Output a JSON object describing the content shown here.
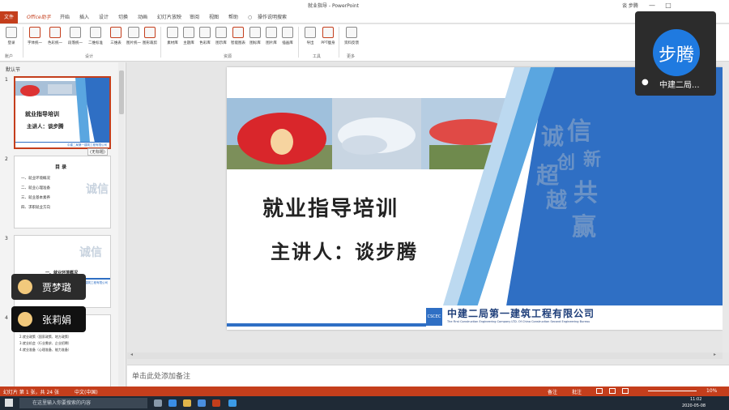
{
  "window": {
    "title": "就业指导 - PowerPoint",
    "user": "谈 步腾",
    "minimize_glyph": "—",
    "maximize_glyph": "□"
  },
  "tabs": [
    "文件",
    "Office助手",
    "开始",
    "插入",
    "设计",
    "切换",
    "动画",
    "幻灯片放映",
    "审阅",
    "视图",
    "帮助",
    "操作说明搜索"
  ],
  "ribbon": {
    "buttons": [
      "登录",
      "字体统一",
      "色彩统一",
      "段落统一",
      "二维标准",
      "三维表",
      "图片统一",
      "图形裁剪",
      "素材库",
      "主题库",
      "色彩库",
      "图示库",
      "智能图表",
      "图标库",
      "图片库",
      "插画库",
      "导出",
      "PPT瘦身",
      "资料反馈"
    ],
    "groups": [
      "账户",
      "设计",
      "资源",
      "工具",
      "更多"
    ]
  },
  "panel": {
    "section": "默认节",
    "slide_numbers": [
      "1",
      "2",
      "3",
      "4"
    ],
    "tooltip": "(无标题)",
    "thumb1": {
      "title": "就业指导培训",
      "speaker": "主讲人：谈步腾",
      "company": "中建二局第一建筑工程有限公司"
    },
    "thumb2": {
      "heading": "目 录",
      "items": [
        "一、就业环境概况",
        "二、就业心理准备",
        "三、就业基本素养",
        "四、求职就业方向"
      ]
    },
    "thumb3": {
      "heading": "一、就业环境概况",
      "company": "中建二局第一建筑工程有限公司"
    },
    "thumb4": {
      "lines": [
        "一、就业环境概况",
        "1.就业形势（总体情况、就业压力较大）",
        "2.就业政策（国家政策、地方政策）",
        "3.就业机会（行业需求、企业招聘）",
        "4.就业准备（心理准备、能力准备）"
      ]
    }
  },
  "slide": {
    "title": "就业指导培训",
    "speaker": "主讲人：谈步腾",
    "calligraphy": [
      "诚",
      "信",
      "创",
      "新",
      "超",
      "越",
      "共",
      "赢"
    ],
    "company": "中建二局第一建筑工程有限公司",
    "company_en": "The First Construction Engineering Company LTD. Of China Construction Second Engineering Bureau",
    "logo_text": "CSCEC"
  },
  "notes": {
    "placeholder": "单击此处添加备注"
  },
  "status": {
    "slide_info": "幻灯片 第 1 张，共 24 张",
    "language": "中文(中国)",
    "notes": "备注",
    "comments": "批注",
    "zoom": "10%"
  },
  "taskbar": {
    "search": "在这里输入你要搜索的内容",
    "time": "11:02",
    "date": "2020-05-08"
  },
  "meeting": {
    "main_speaker": {
      "avatar_text": "步腾",
      "name": "中建二局..."
    },
    "participants": [
      {
        "name": "贾梦璐"
      },
      {
        "name": "张莉娟"
      }
    ]
  },
  "colors": {
    "accent": "#c43e1c",
    "slide_blue": "#2f6fc4",
    "slide_blue_light": "#5aa6e0",
    "avatar": "#1f7ae0"
  }
}
